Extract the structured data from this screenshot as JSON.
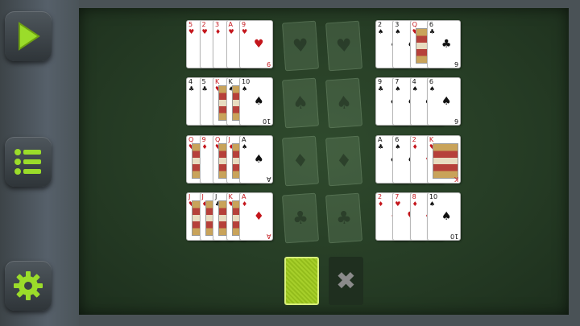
{
  "sidebar": {
    "buttons": [
      {
        "name": "play-button",
        "icon": "play-icon"
      },
      {
        "name": "menu-button",
        "icon": "list-icon"
      },
      {
        "name": "settings-button",
        "icon": "gear-icon"
      }
    ],
    "accent_color": "#9bdc2a"
  },
  "tableau": {
    "rows": [
      {
        "left": [
          {
            "rank": "5",
            "suit": "♥",
            "color": "red"
          },
          {
            "rank": "2",
            "suit": "♥",
            "color": "red"
          },
          {
            "rank": "3",
            "suit": "♦",
            "color": "red"
          },
          {
            "rank": "A",
            "suit": "♥",
            "color": "red"
          },
          {
            "rank": "9",
            "suit": "♥",
            "color": "red"
          }
        ],
        "foundation_suits": [
          "♥",
          "♥"
        ],
        "right": [
          {
            "rank": "2",
            "suit": "♠",
            "color": "blk"
          },
          {
            "rank": "3",
            "suit": "♠",
            "color": "blk"
          },
          {
            "rank": "Q",
            "suit": "♥",
            "color": "red"
          },
          {
            "rank": "6",
            "suit": "♣",
            "color": "blk"
          }
        ]
      },
      {
        "left": [
          {
            "rank": "4",
            "suit": "♣",
            "color": "blk"
          },
          {
            "rank": "5",
            "suit": "♣",
            "color": "blk"
          },
          {
            "rank": "K",
            "suit": "♥",
            "color": "red"
          },
          {
            "rank": "K",
            "suit": "♠",
            "color": "blk"
          },
          {
            "rank": "10",
            "suit": "♠",
            "color": "blk"
          }
        ],
        "foundation_suits": [
          "♠",
          "♠"
        ],
        "right": [
          {
            "rank": "9",
            "suit": "♣",
            "color": "blk"
          },
          {
            "rank": "7",
            "suit": "♠",
            "color": "blk"
          },
          {
            "rank": "4",
            "suit": "♠",
            "color": "blk"
          },
          {
            "rank": "6",
            "suit": "♠",
            "color": "blk"
          }
        ]
      },
      {
        "left": [
          {
            "rank": "Q",
            "suit": "♥",
            "color": "red"
          },
          {
            "rank": "9",
            "suit": "♦",
            "color": "red"
          },
          {
            "rank": "Q",
            "suit": "♥",
            "color": "red"
          },
          {
            "rank": "J",
            "suit": "♦",
            "color": "red"
          },
          {
            "rank": "A",
            "suit": "♠",
            "color": "blk"
          }
        ],
        "foundation_suits": [
          "♦",
          "♦"
        ],
        "right": [
          {
            "rank": "A",
            "suit": "♣",
            "color": "blk"
          },
          {
            "rank": "6",
            "suit": "♠",
            "color": "blk"
          },
          {
            "rank": "2",
            "suit": "♦",
            "color": "red"
          },
          {
            "rank": "K",
            "suit": "♥",
            "color": "red"
          }
        ]
      },
      {
        "left": [
          {
            "rank": "J",
            "suit": "♥",
            "color": "red"
          },
          {
            "rank": "J",
            "suit": "♦",
            "color": "red"
          },
          {
            "rank": "J",
            "suit": "♣",
            "color": "blk"
          },
          {
            "rank": "K",
            "suit": "♥",
            "color": "red"
          },
          {
            "rank": "A",
            "suit": "♦",
            "color": "red"
          }
        ],
        "foundation_suits": [
          "♣",
          "♣"
        ],
        "right": [
          {
            "rank": "2",
            "suit": "♦",
            "color": "red"
          },
          {
            "rank": "7",
            "suit": "♥",
            "color": "red"
          },
          {
            "rank": "8",
            "suit": "♦",
            "color": "red"
          },
          {
            "rank": "10",
            "suit": "♠",
            "color": "blk"
          }
        ]
      }
    ]
  },
  "stock": {
    "icon": "card-back-icon"
  },
  "discard": {
    "icon": "close-icon",
    "glyph": "✖"
  }
}
